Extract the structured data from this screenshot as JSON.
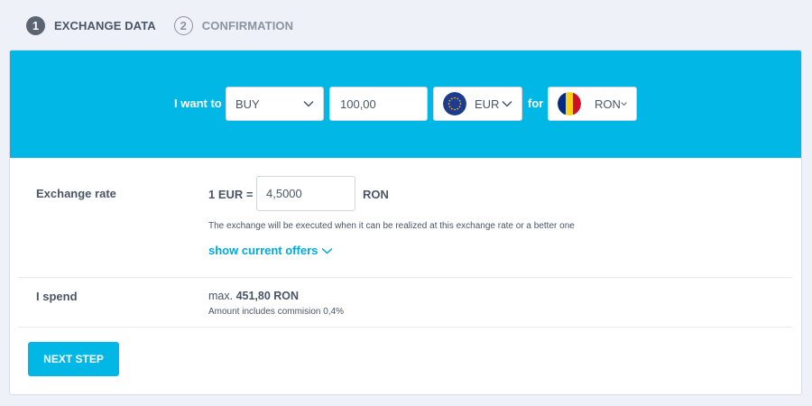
{
  "steps": [
    {
      "number": "1",
      "label": "EXCHANGE DATA",
      "state": "active"
    },
    {
      "number": "2",
      "label": "CONFIRMATION",
      "state": "inactive"
    }
  ],
  "exchange_form": {
    "prefix_label": "I want to",
    "action_select": {
      "value": "BUY"
    },
    "amount_input": {
      "value": "100,00"
    },
    "from_currency": {
      "value": "EUR",
      "icon": "eu-flag-icon"
    },
    "for_label": "for",
    "to_currency": {
      "value": "RON",
      "icon": "romania-flag-icon"
    }
  },
  "exchange_rate": {
    "label": "Exchange rate",
    "prefix": "1 EUR =",
    "value": "4,5000",
    "suffix": "RON",
    "note": "The exchange will be executed when it can be realized at this exchange rate or a better one",
    "show_offers_link": "show current offers"
  },
  "spend": {
    "label": "I spend",
    "prefix": "max.",
    "amount": "451,80 RON",
    "note": "Amount includes commision 0,4%"
  },
  "next_button": {
    "label": "NEXT STEP"
  },
  "colors": {
    "accent": "#00b7e6",
    "link": "#00a9d8",
    "background": "#eef1f7",
    "text": "#4a5566"
  }
}
